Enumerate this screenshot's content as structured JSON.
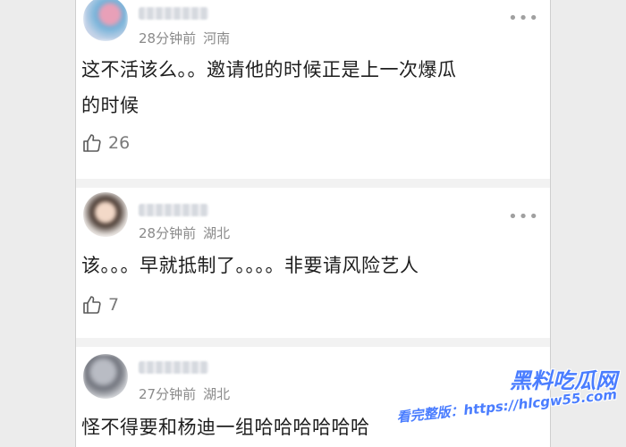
{
  "comments": [
    {
      "time": "28分钟前",
      "location": "河南",
      "text_lines": [
        "这不活该么。。邀请他的时候正是上一次爆瓜",
        "的时候"
      ],
      "likes": "26"
    },
    {
      "time": "28分钟前",
      "location": "湖北",
      "text_lines": [
        "该。。。早就抵制了。。。。非要请风险艺人"
      ],
      "likes": "7"
    },
    {
      "time": "27分钟前",
      "location": "湖北",
      "text_lines": [
        "怪不得要和杨迪一组哈哈哈哈哈哈"
      ]
    }
  ],
  "watermark": {
    "title": "黑料吃瓜网",
    "subtitle": "看完整版：https://hlcgw55.com"
  },
  "icons": {
    "more": "more-dots-icon",
    "like": "thumbs-up-icon"
  }
}
